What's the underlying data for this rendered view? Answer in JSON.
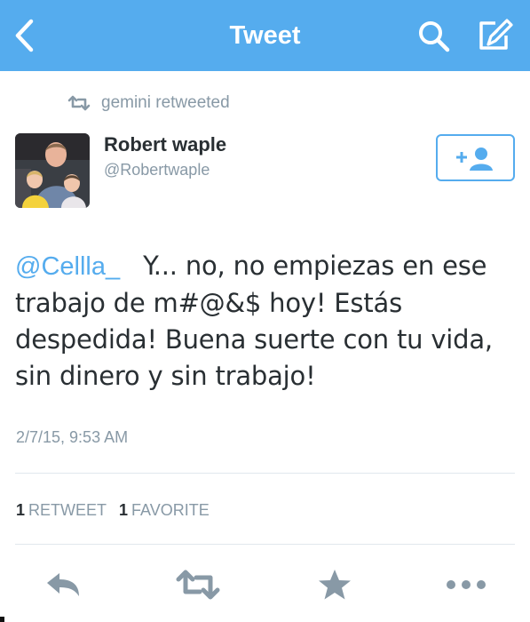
{
  "nav": {
    "title": "Tweet",
    "back_icon": "chevron-left-icon",
    "search_icon": "search-icon",
    "compose_icon": "compose-icon",
    "bar_color": "#55acee"
  },
  "retweet_context": {
    "text": "gemini retweeted",
    "icon": "retweet-icon"
  },
  "author": {
    "name": "Robert waple",
    "handle": "@Robertwaple",
    "follow_icon": "add-user-icon"
  },
  "tweet": {
    "mention": "@Cellla_",
    "body": "Y... no, no empiezas en ese trabajo de m#@&$ hoy! Estás despedida! Buena suerte con tu vida, sin dinero y sin trabajo!",
    "timestamp": "2/7/15, 9:53 AM"
  },
  "stats": {
    "retweets_count": "1",
    "retweets_label": "RETWEET",
    "favorites_count": "1",
    "favorites_label": "FAVORITE"
  },
  "actions": {
    "reply_icon": "reply-icon",
    "retweet_icon": "retweet-icon",
    "favorite_icon": "star-icon",
    "more_icon": "more-icon"
  },
  "colors": {
    "accent": "#55acee",
    "text": "#292f33",
    "secondary": "#8899a6",
    "divider": "#e1e8ed"
  }
}
